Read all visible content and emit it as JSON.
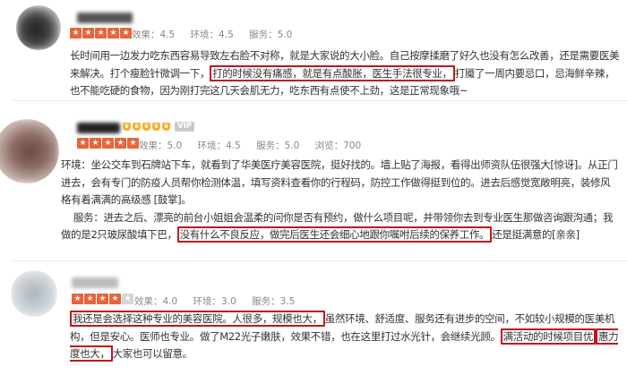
{
  "reviews": [
    {
      "meta": {
        "effect": "效果：4.5",
        "environment": "环境：4.5",
        "service": "服务：5.0"
      },
      "stars_filled": 5,
      "text": {
        "p1": "长时间用一边发力吃东西容易导致左右脸不对称，就是大家说的大小脸。自己按摩揉磨了好久也没有怎么改善，还是需要医美来解决。打个瘦脸针微调一下，",
        "h1": "打的时候没有痛感，就是有点酸胀，医生手法很专业，",
        "p2": "打魇了一周内要忌口，忌海鲜辛辣，也不能吃硬的食物，因为刚打完这几天会肌无力，吃东西有点使不上劲，这是正常现象哦~"
      }
    },
    {
      "meta": {
        "effect": "效果：5.0",
        "environment": "环境：4.5",
        "service": "服务：5.0",
        "views": "浏览：700"
      },
      "stars_filled": 5,
      "badge": "VIP",
      "text": {
        "l1": "环境：坐公交车到石牌站下车，就看到了华美医疗美容医院，挺好找的。墙上贴了海报，看得出师资队伍很强大[惊讶]。从正门进去，会有专门的防疫人员帮你检测体温，填写资料查看你的行程码，防控工作做得挺到位的。进去后感觉宽敞明亮，装修风格有着满满的高级感 [鼓掌]。",
        "l2a": "服务：进去之后、漂亮的前台小姐姐会温柔的问你是否有预约，做什么项目呢，并带领你去到专业医生那做咨询跟沟通；我做的是2只玻尿酸填下巴，",
        "h1": "没有什么不良反应，做完后医生还会细心地跟你嘱咐后续的保养工作。",
        "l2b": "还是挺满意的[亲亲]"
      }
    },
    {
      "meta": {
        "effect": "效果：4.0",
        "environment": "环境：3.0",
        "service": "服务：3.5"
      },
      "stars_filled": 4,
      "text": {
        "h1": "我还是会选择这种专业的美容医院。人很多，规模也大，",
        "p1": "虽然环境、舒适度、服务还有进步的空间，不如较小规模的医美机构，但是安心。医师也专业。做了M22光子嫩肤，效果不错，也在这里打过水光针，会继续光顾。",
        "h2": "满活动的时候项目优",
        "h3": "惠力度也大，",
        "p2": "大家也可以留意。"
      }
    }
  ]
}
